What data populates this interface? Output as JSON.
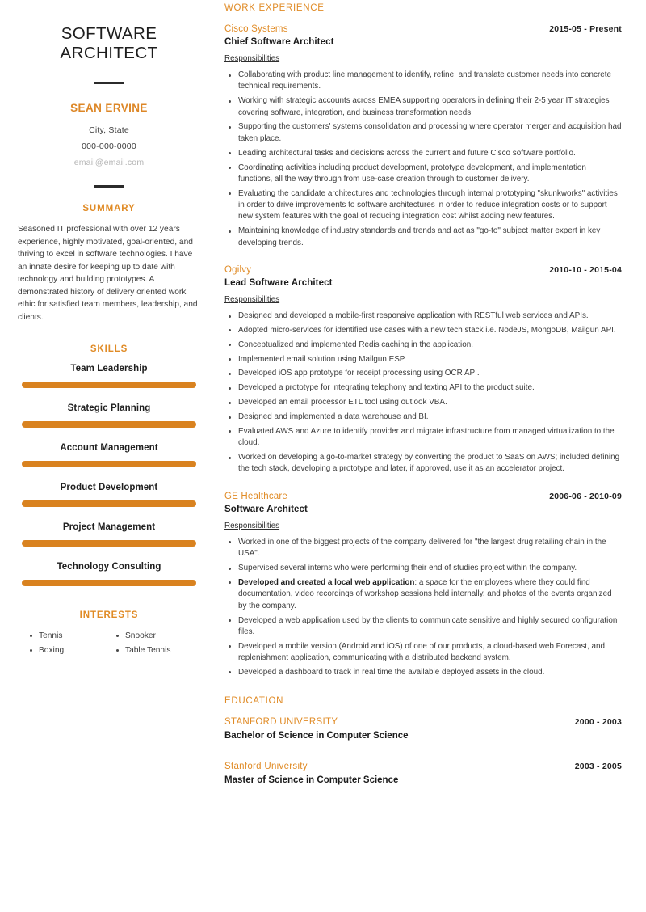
{
  "sidebar": {
    "job_title": "SOFTWARE ARCHITECT",
    "person_name": "SEAN ERVINE",
    "location": "City, State",
    "phone": "000-000-0000",
    "email": "email@email.com",
    "summary_heading": "SUMMARY",
    "summary_text": "Seasoned IT professional with over 12 years experience, highly motivated, goal-oriented, and thriving to excel in software technologies. I have an innate desire for keeping up to date with technology and building prototypes. A demonstrated history of delivery oriented work ethic for satisfied team members, leadership, and clients.",
    "skills_heading": "SKILLS",
    "skills": [
      {
        "name": "Team Leadership",
        "level": 100
      },
      {
        "name": "Strategic Planning",
        "level": 100
      },
      {
        "name": "Account Management",
        "level": 100
      },
      {
        "name": "Product Development",
        "level": 100
      },
      {
        "name": "Project Management",
        "level": 100
      },
      {
        "name": "Technology Consulting",
        "level": 100
      }
    ],
    "interests_heading": "INTERESTS",
    "interests_left": [
      "Tennis",
      "Boxing"
    ],
    "interests_right": [
      "Snooker",
      "Table Tennis"
    ]
  },
  "main": {
    "work_heading": "WORK EXPERIENCE",
    "responsibilities_label": "Responsibilities",
    "experience": [
      {
        "org": "Cisco Systems",
        "dates": "2015-05 - Present",
        "role": "Chief Software Architect",
        "bullets": [
          "Collaborating with product line management to identify, refine, and translate customer needs into concrete technical requirements.",
          "Working with strategic accounts across EMEA supporting operators in defining their 2-5 year IT strategies covering software, integration, and business transformation needs.",
          "Supporting the customers' systems consolidation and processing where operator merger and acquisition had taken place.",
          "Leading architectural tasks and decisions across the current and future Cisco software portfolio.",
          "Coordinating activities including product development, prototype development, and implementation functions, all the way through from use-case creation through to customer delivery.",
          "Evaluating the candidate architectures and technologies through internal prototyping \"skunkworks\" activities in order to drive improvements to software architectures in order to reduce integration costs or to support new system features with the goal of reducing integration cost whilst adding new features.",
          "Maintaining knowledge of industry standards and trends and act as \"go-to\" subject matter expert in key developing trends."
        ]
      },
      {
        "org": "Ogilvy",
        "dates": "2010-10 - 2015-04",
        "role": "Lead Software Architect",
        "bullets": [
          "Designed and developed a mobile-first responsive application with RESTful web services and APIs.",
          "Adopted micro-services for identified use cases with a new tech stack i.e. NodeJS, MongoDB, Mailgun API.",
          "Conceptualized and implemented Redis caching in the application.",
          "Implemented email solution using Mailgun ESP.",
          "Developed iOS app prototype for receipt processing using OCR API.",
          "Developed a prototype for integrating telephony and texting API to the product suite.",
          "Developed an email processor ETL tool using outlook VBA.",
          "Designed and implemented a data warehouse and BI.",
          "Evaluated AWS and Azure to identify provider and migrate infrastructure from managed virtualization to the cloud.",
          "Worked on developing a go-to-market strategy by converting the product to SaaS on AWS; included defining the tech stack, developing a prototype and later, if approved, use it as an accelerator project."
        ]
      },
      {
        "org": "GE Healthcare",
        "dates": "2006-06 - 2010-09",
        "role": "Software Architect",
        "bullets": [
          "Worked in one of the biggest projects of the company delivered for \"the largest drug retailing chain in the USA\".",
          "Supervised several interns who were performing their end of studies project within the company.",
          "<b>Developed and created a local web application</b>: a space for the employees where they could find documentation, video recordings of workshop sessions held internally, and photos of the events organized by the company.",
          "Developed a web application used by the clients to communicate sensitive and highly secured configuration files.",
          "Developed a mobile version (Android and iOS) of one of our products, a cloud-based web Forecast, and replenishment application, communicating with a distributed backend system.",
          "Developed a dashboard to track in real time the available deployed assets in the cloud."
        ]
      }
    ],
    "education_heading": "EDUCATION",
    "education": [
      {
        "school": "STANFORD UNIVERSITY",
        "dates": "2000 - 2003",
        "degree": "Bachelor of Science in Computer Science"
      },
      {
        "school": "Stanford University",
        "dates": "2003 - 2005",
        "degree": "Master of Science in Computer Science"
      }
    ]
  },
  "colors": {
    "accent": "#e08b26",
    "bar": "#d9821f",
    "text": "#3c3c3c",
    "heading": "#1b1b1b"
  }
}
